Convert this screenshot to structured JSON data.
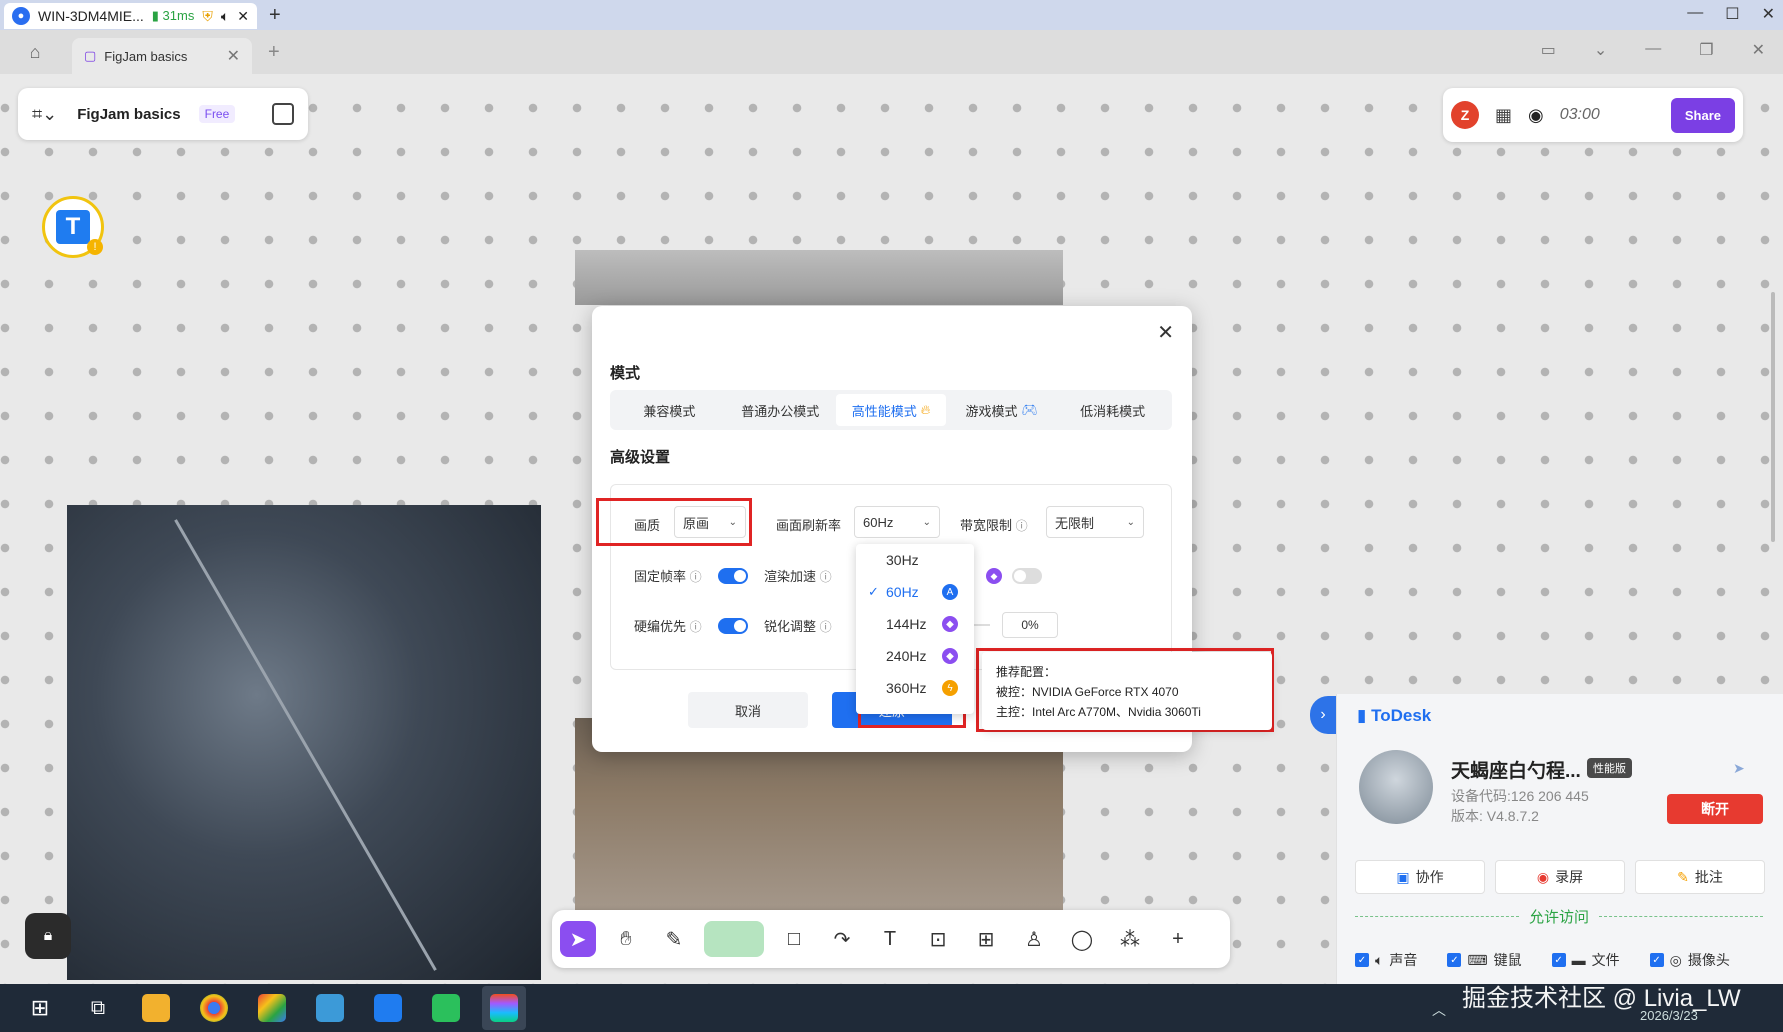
{
  "remote_bar": {
    "session_name": "WIN-3DM4MIE...",
    "ping": "31ms",
    "user_icon": "user-icon",
    "shield_icon": "shield-icon"
  },
  "browser": {
    "tab_title": "FigJam basics"
  },
  "figjam": {
    "file_title": "FigJam basics",
    "plan_badge": "Free",
    "user_initial": "Z",
    "timer": "03:00",
    "share_label": "Share"
  },
  "modal": {
    "mode_title": "模式",
    "modes": [
      {
        "label": "兼容模式",
        "active": false
      },
      {
        "label": "普通办公模式",
        "active": false
      },
      {
        "label": "高性能模式",
        "active": true
      },
      {
        "label": "游戏模式",
        "active": false
      },
      {
        "label": "低消耗模式",
        "active": false
      }
    ],
    "advanced_title": "高级设置",
    "quality_label": "画质",
    "quality_value": "原画",
    "refresh_label": "画面刷新率",
    "refresh_value": "60Hz",
    "bandwidth_label": "带宽限制",
    "bandwidth_value": "无限制",
    "fixed_fps_label": "固定帧率",
    "render_accel_label": "渲染加速",
    "hw_encode_label": "硬编优先",
    "sharpen_label": "锐化调整",
    "sharpen_value": "0%",
    "cancel_label": "取消",
    "restore_label": "还原"
  },
  "refresh_dropdown": {
    "options": [
      {
        "label": "30Hz",
        "selected": false
      },
      {
        "label": "60Hz",
        "selected": true
      },
      {
        "label": "144Hz",
        "selected": false
      },
      {
        "label": "240Hz",
        "selected": false
      },
      {
        "label": "360Hz",
        "selected": false
      }
    ]
  },
  "tooltip": {
    "title": "推荐配置：",
    "controlled": "被控：NVIDIA GeForce RTX 4070",
    "controller": "主控：Intel Arc A770M、Nvidia 3060Ti"
  },
  "todesk_panel": {
    "brand": "ToDesk",
    "device_name": "天蝎座白勺程...",
    "perf_badge": "性能版",
    "device_code": "设备代码:126 206 445",
    "version": "版本: V4.8.7.2",
    "disconnect_label": "断开",
    "actions": [
      "协作",
      "录屏",
      "批注"
    ],
    "allow_title": "允许访问",
    "permissions": [
      "声音",
      "键鼠",
      "文件",
      "摄像头"
    ]
  },
  "taskbar": {
    "watermark": "掘金技术社区 @ Livia_LW",
    "date": "2026/3/23"
  },
  "colors": {
    "accent_blue": "#1f6ff0",
    "figjam_purple": "#7b3fe4",
    "highlight_red": "#e02424",
    "disconnect_red": "#e73a30"
  }
}
